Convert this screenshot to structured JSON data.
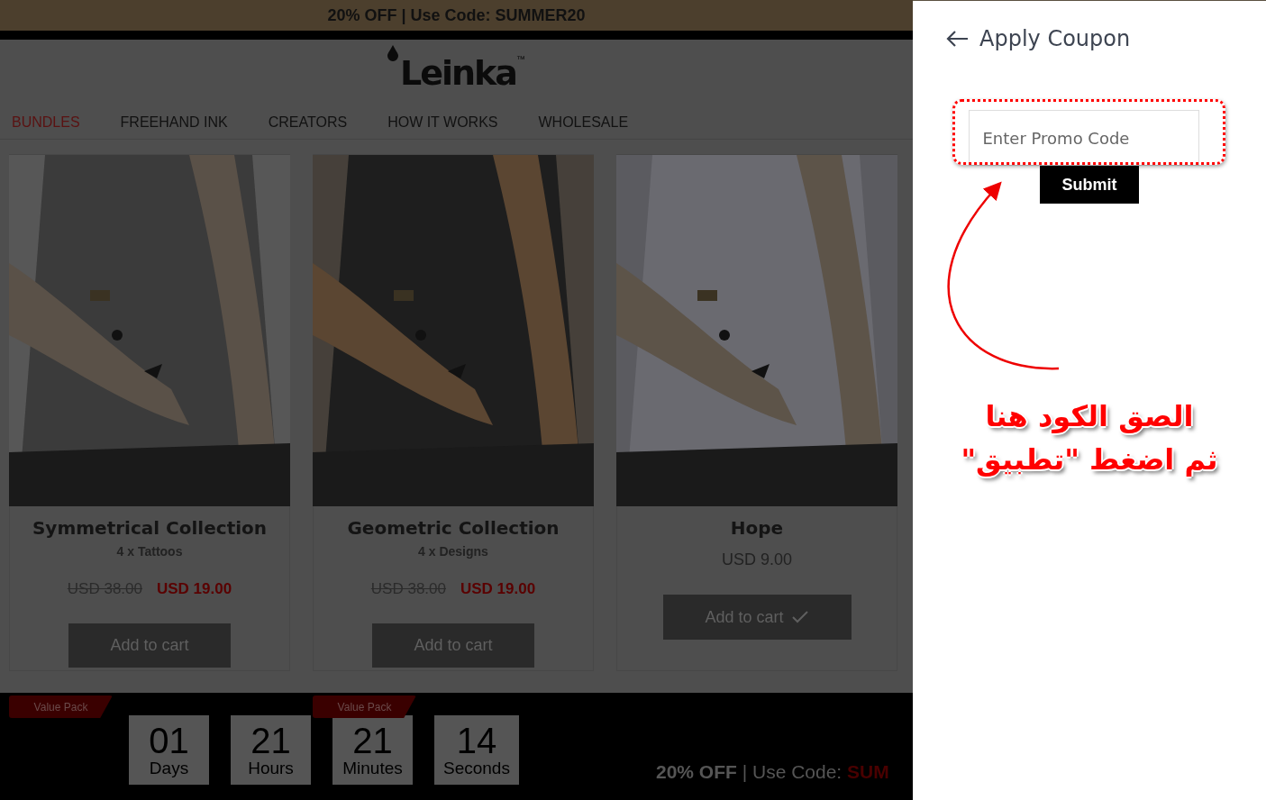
{
  "banner": {
    "text": "20% OFF  | Use Code: SUMMER20"
  },
  "logo": {
    "text": "Leinka",
    "trademark": "™"
  },
  "nav": [
    {
      "label": "BUNDLES",
      "selected": true
    },
    {
      "label": "FREEHAND INK",
      "selected": false
    },
    {
      "label": "CREATORS",
      "selected": false
    },
    {
      "label": "HOW IT WORKS",
      "selected": false
    },
    {
      "label": "WHOLESALE",
      "selected": false
    }
  ],
  "products": [
    {
      "title": "Symmetrical Collection",
      "subtitle": "4 x Tattoos",
      "old_price": "USD 38.00",
      "price": "USD 19.00",
      "on_sale": true,
      "button": "Add to cart",
      "added": false
    },
    {
      "title": "Geometric Collection",
      "subtitle": "4 x Designs",
      "old_price": "USD 38.00",
      "price": "USD 19.00",
      "on_sale": true,
      "button": "Add to cart",
      "added": false
    },
    {
      "title": "Hope",
      "price": "USD 9.00",
      "on_sale": false,
      "button": "Add to cart",
      "added": true
    }
  ],
  "countdown": [
    {
      "value": "01",
      "label": "Days"
    },
    {
      "value": "21",
      "label": "Hours"
    },
    {
      "value": "21",
      "label": "Minutes"
    },
    {
      "value": "14",
      "label": "Seconds"
    }
  ],
  "badges": [
    "Value Pack",
    "Value Pack"
  ],
  "footer_promo": {
    "offer": "20% OFF",
    "text": "| Use Code:",
    "code": "SUM"
  },
  "coupon_panel": {
    "title": "Apply Coupon",
    "placeholder": "Enter Promo Code",
    "submit": "Submit"
  },
  "annotation": {
    "lines": [
      "الصق الكود هنا",
      "ثم اضغط \"تطبيق\""
    ]
  }
}
